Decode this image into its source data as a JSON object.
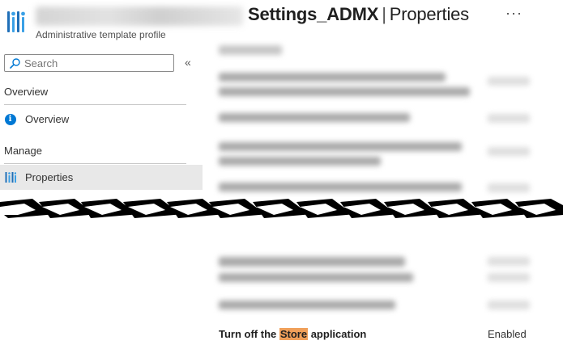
{
  "header": {
    "title_main": "Settings_ADMX",
    "title_separator": "|",
    "title_section": "Properties",
    "subtitle": "Administrative template profile",
    "more_label": "···"
  },
  "sidebar": {
    "search_placeholder": "Search",
    "collapse_label": "«",
    "sections": [
      {
        "label": "Overview",
        "items": [
          {
            "label": "Overview",
            "icon": "info-icon"
          }
        ]
      },
      {
        "label": "Manage",
        "items": [
          {
            "label": "Properties",
            "icon": "settings-bars-icon",
            "selected": true
          }
        ]
      }
    ]
  },
  "settings": {
    "visible_row": {
      "name_before": "Turn off the ",
      "name_highlight": "Store",
      "name_after": " application",
      "state": "Enabled"
    }
  },
  "colors": {
    "accent": "#0078d4",
    "highlight": "#f0a05a",
    "selected_bg": "#e8e8e8"
  }
}
